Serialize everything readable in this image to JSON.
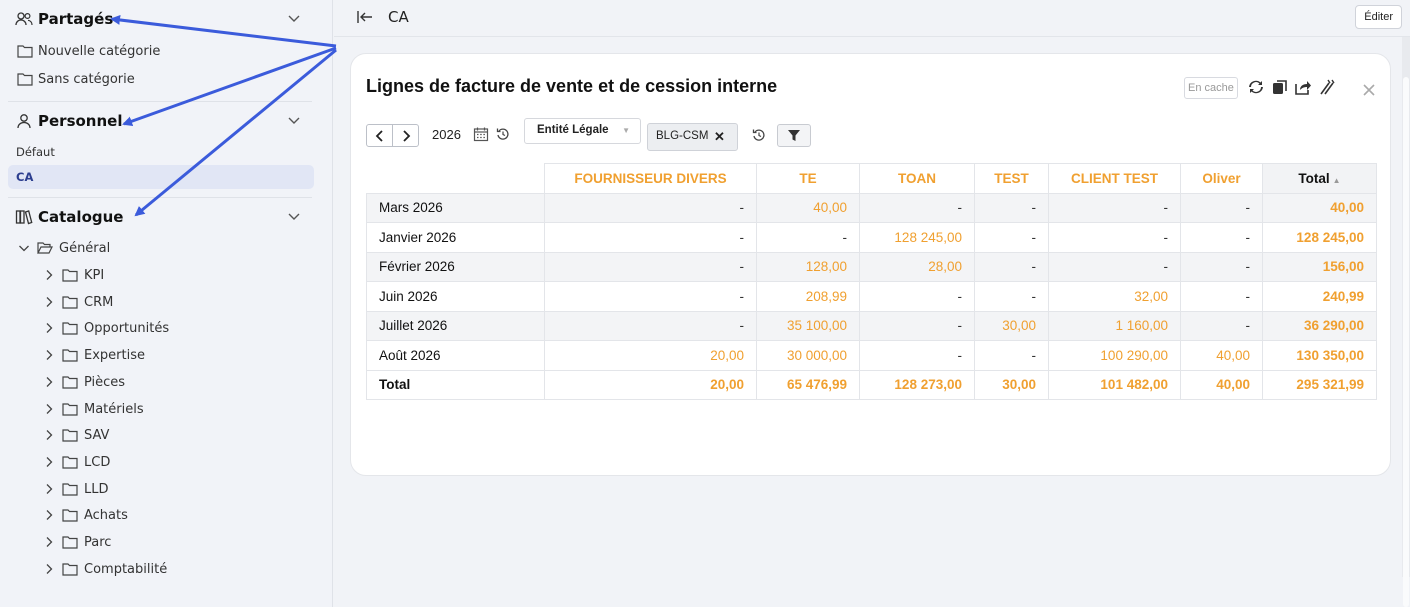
{
  "sidebar": {
    "shared": {
      "title": "Partagés",
      "folders": [
        "Nouvelle catégorie",
        "Sans catégorie"
      ]
    },
    "personal": {
      "title": "Personnel",
      "items": [
        "Défaut",
        "CA"
      ]
    },
    "catalog": {
      "title": "Catalogue",
      "root": "Général",
      "children": [
        "KPI",
        "CRM",
        "Opportunités",
        "Expertise",
        "Pièces",
        "Matériels",
        "SAV",
        "LCD",
        "LLD",
        "Achats",
        "Parc",
        "Comptabilité"
      ]
    }
  },
  "topbar": {
    "page_title": "CA",
    "edit_label": "Éditer"
  },
  "card": {
    "title": "Lignes de facture de vente et de cession interne",
    "cache_label": "En cache",
    "year": "2026",
    "entity_filter_label": "Entité Légale",
    "entity_chip": "BLG-CSM"
  },
  "table": {
    "columns": [
      "FOURNISSEUR DIVERS",
      "TE",
      "TOAN",
      "TEST",
      "CLIENT TEST",
      "Oliver",
      "Total"
    ],
    "rows": [
      {
        "label": "Mars 2026",
        "cells": [
          "-",
          "40,00",
          "-",
          "-",
          "-",
          "-",
          "40,00"
        ]
      },
      {
        "label": "Janvier 2026",
        "cells": [
          "-",
          "-",
          "128 245,00",
          "-",
          "-",
          "-",
          "128 245,00"
        ]
      },
      {
        "label": "Février 2026",
        "cells": [
          "-",
          "128,00",
          "28,00",
          "-",
          "-",
          "-",
          "156,00"
        ]
      },
      {
        "label": "Juin 2026",
        "cells": [
          "-",
          "208,99",
          "-",
          "-",
          "32,00",
          "-",
          "240,99"
        ]
      },
      {
        "label": "Juillet 2026",
        "cells": [
          "-",
          "35 100,00",
          "-",
          "30,00",
          "1 160,00",
          "-",
          "36 290,00"
        ]
      },
      {
        "label": "Août 2026",
        "cells": [
          "20,00",
          "30 000,00",
          "-",
          "-",
          "100 290,00",
          "40,00",
          "130 350,00"
        ]
      }
    ],
    "total_row": {
      "label": "Total",
      "cells": [
        "20,00",
        "65 476,99",
        "128 273,00",
        "30,00",
        "101 482,00",
        "40,00",
        "295 321,99"
      ]
    }
  },
  "colors": {
    "accent_orange": "#f0a030",
    "annotation_arrow": "#3b5bdb",
    "active_bg": "#e1e6f5"
  }
}
